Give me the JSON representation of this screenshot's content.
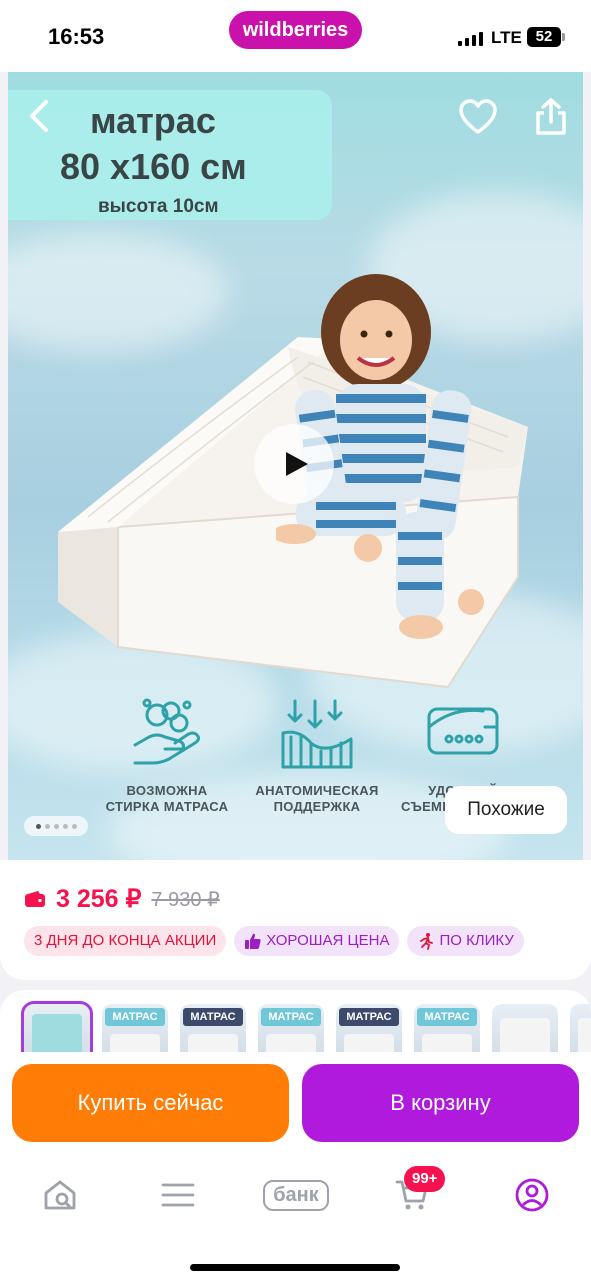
{
  "status_bar": {
    "time": "16:53",
    "brand": "wildberries",
    "network": "LTE",
    "battery": "52"
  },
  "hero": {
    "title_line1": "матрас",
    "title_line2": "80 х160 см",
    "title_line3": "высота 10см",
    "features": [
      {
        "line1": "ВОЗМОЖНА",
        "line2": "СТИРКА МАТРАСА"
      },
      {
        "line1": "АНАТОМИЧЕСКАЯ",
        "line2": "ПОДДЕРЖКА"
      },
      {
        "line1": "УДОБНЫЙ",
        "line2": "СЪЕМНЫЙ ЧЕХОЛ"
      }
    ],
    "similar_label": "Похожие",
    "carousel_position": 1,
    "carousel_count": 5
  },
  "product": {
    "price": "3 256 ₽",
    "old_price": "7 930 ₽",
    "tags": [
      "3 ДНЯ ДО КОНЦА АКЦИИ",
      "ХОРОШАЯ ЦЕНА",
      "ПО КЛИКУ"
    ]
  },
  "thumbnails": [
    {
      "label": "",
      "selected": true
    },
    {
      "label": "МАТРАС",
      "selected": false
    },
    {
      "label": "МАТРАС",
      "selected": false
    },
    {
      "label": "МАТРАС",
      "selected": false
    },
    {
      "label": "МАТРАС",
      "selected": false
    },
    {
      "label": "МАТРАС",
      "selected": false
    },
    {
      "label": "",
      "selected": false
    },
    {
      "label": "",
      "selected": false
    }
  ],
  "actions": {
    "buy_now": "Купить сейчас",
    "add_to_cart": "В корзину"
  },
  "tab_bar": {
    "bank_label": "банк",
    "cart_badge": "99+"
  },
  "colors": {
    "brand": "#cb11ab",
    "price": "#f5124e",
    "buy_now": "#ff7d06",
    "cart": "#b01adc"
  },
  "icons": [
    "back-icon",
    "heart-icon",
    "share-icon",
    "play-icon",
    "home-search-icon",
    "menu-icon",
    "cart-icon",
    "profile-icon"
  ]
}
